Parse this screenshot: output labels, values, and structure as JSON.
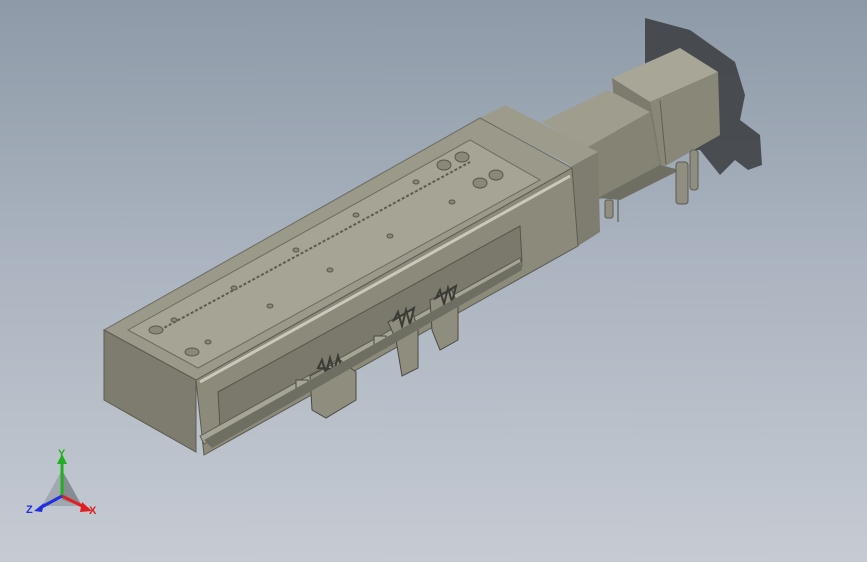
{
  "viewport": {
    "background_top": "#8e9aa8",
    "background_bottom": "#c6cbd3",
    "model_color": "#8d8c7c"
  },
  "triad": {
    "x_label": "X",
    "y_label": "Y",
    "z_label": "Z",
    "x_color": "#e02020",
    "y_color": "#20b020",
    "z_color": "#2030e0"
  }
}
